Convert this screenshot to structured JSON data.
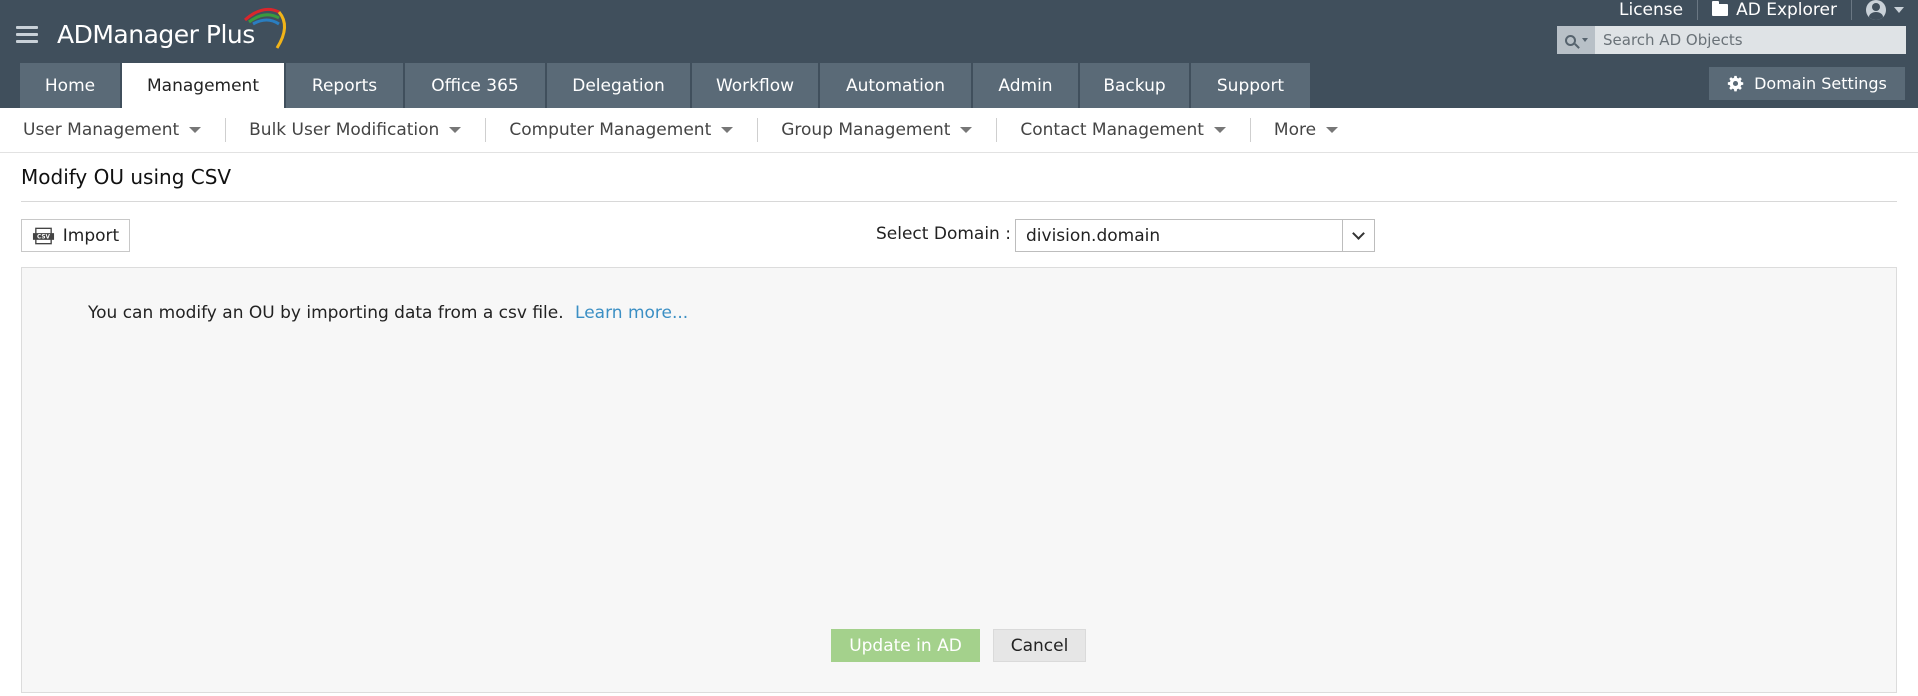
{
  "header": {
    "app_name": "ADManager Plus",
    "links": {
      "license": "License",
      "ad_explorer": "AD Explorer"
    },
    "search": {
      "placeholder": "Search AD Objects",
      "value": ""
    },
    "domain_settings_label": "Domain Settings"
  },
  "tabs": [
    {
      "label": "Home"
    },
    {
      "label": "Management",
      "active": true
    },
    {
      "label": "Reports"
    },
    {
      "label": "Office 365"
    },
    {
      "label": "Delegation"
    },
    {
      "label": "Workflow"
    },
    {
      "label": "Automation"
    },
    {
      "label": "Admin"
    },
    {
      "label": "Backup"
    },
    {
      "label": "Support"
    }
  ],
  "subnav": [
    {
      "label": "User Management"
    },
    {
      "label": "Bulk User Modification"
    },
    {
      "label": "Computer Management"
    },
    {
      "label": "Group Management"
    },
    {
      "label": "Contact Management"
    },
    {
      "label": "More"
    }
  ],
  "page": {
    "title": "Modify OU using CSV",
    "import_label": "Import",
    "domain_label": "Select Domain :",
    "domain_value": "division.domain",
    "info_text": "You can modify an OU by importing data from a csv file.",
    "learn_more": "Learn more...",
    "update_label": "Update in AD",
    "cancel_label": "Cancel"
  },
  "colors": {
    "header_bg": "#404f5c",
    "tab_bg": "#5a6a77",
    "update_btn": "#a4d18c",
    "link": "#3b8fc4"
  }
}
